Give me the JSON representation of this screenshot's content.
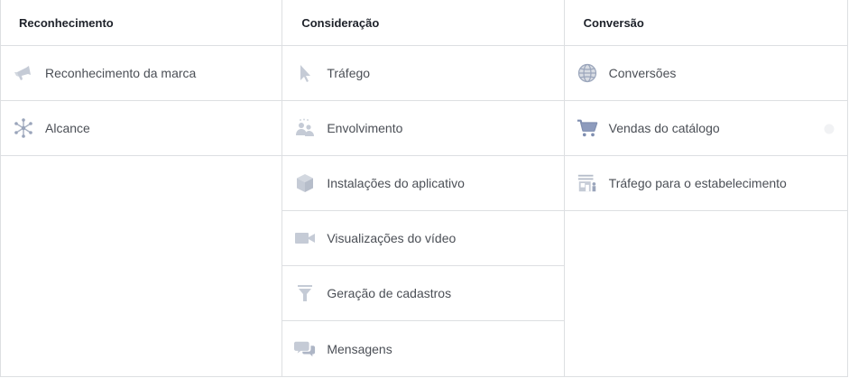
{
  "columns": [
    {
      "header": "Reconhecimento",
      "items": [
        {
          "label": "Reconhecimento da marca",
          "icon": "megaphone-icon"
        },
        {
          "label": "Alcance",
          "icon": "reach-icon"
        }
      ]
    },
    {
      "header": "Consideração",
      "items": [
        {
          "label": "Tráfego",
          "icon": "cursor-icon"
        },
        {
          "label": "Envolvimento",
          "icon": "people-icon"
        },
        {
          "label": "Instalações do aplicativo",
          "icon": "box-icon"
        },
        {
          "label": "Visualizações do vídeo",
          "icon": "video-camera-icon"
        },
        {
          "label": "Geração de cadastros",
          "icon": "funnel-icon"
        },
        {
          "label": "Mensagens",
          "icon": "chat-bubbles-icon"
        }
      ]
    },
    {
      "header": "Conversão",
      "items": [
        {
          "label": "Conversões",
          "icon": "globe-icon"
        },
        {
          "label": "Vendas do catálogo",
          "icon": "shopping-cart-icon"
        },
        {
          "label": "Tráfego para o estabelecimento",
          "icon": "storefront-icon"
        }
      ]
    }
  ],
  "colors": {
    "icon_gray": "#bec3c9",
    "icon_blue": "#8d9bbd",
    "border": "#dddfe2",
    "text": "#4b4f56",
    "header_text": "#1d2129"
  }
}
